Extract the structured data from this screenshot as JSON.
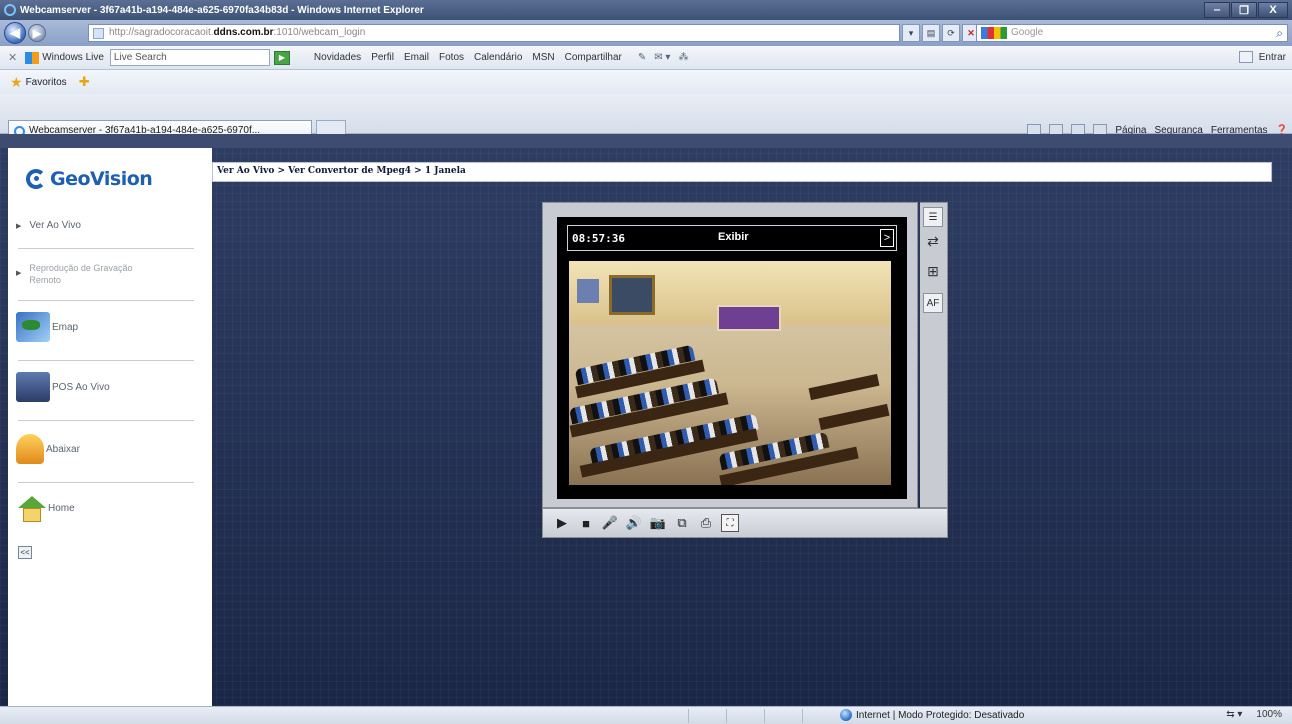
{
  "window": {
    "title": "Webcamserver - 3f67a41b-a194-484e-a625-6970fa34b83d - Windows Internet Explorer",
    "minimize": "‒",
    "maximize": "❐",
    "close": "X"
  },
  "address": {
    "url_prefix": "http://sagradocoracaoit.",
    "url_domain": "ddns.com.br",
    "url_suffix": ":1010/webcam_login",
    "search_placeholder": "Google"
  },
  "live_toolbar": {
    "brand": "Windows Live",
    "search_placeholder": "Live Search",
    "links": [
      "Novidades",
      "Perfil",
      "Email",
      "Fotos",
      "Calendário",
      "MSN",
      "Compartilhar"
    ],
    "signin": "Entrar"
  },
  "favorites_bar": {
    "label": "Favoritos"
  },
  "tab": {
    "title": "Webcamserver - 3f67a41b-a194-484e-a625-6970f..."
  },
  "command_bar": {
    "page": "Página",
    "security": "Segurança",
    "tools": "Ferramentas"
  },
  "sidebar": {
    "brand": "GeoVision",
    "items": [
      {
        "label": "Ver Ao Vivo"
      },
      {
        "label": "Reprodução de Gravação Remoto"
      },
      {
        "label": "Emap"
      },
      {
        "label": "POS Ao Vivo"
      },
      {
        "label": "Abaixar"
      },
      {
        "label": "Home"
      }
    ],
    "collapse_label": "<<"
  },
  "breadcrumb": "Ver Ao Vivo > Ver Convertor de Mpeg4 > 1 Janela",
  "player": {
    "time": "08:57:36",
    "view_label": "Exibir",
    "next_label": ">"
  },
  "status_bar": {
    "zone": "Internet | Modo Protegido: Desativado",
    "zoom": "100%"
  },
  "colors": {
    "page_bg": "#1d2a4d",
    "brand_blue": "#1c5fb3"
  }
}
